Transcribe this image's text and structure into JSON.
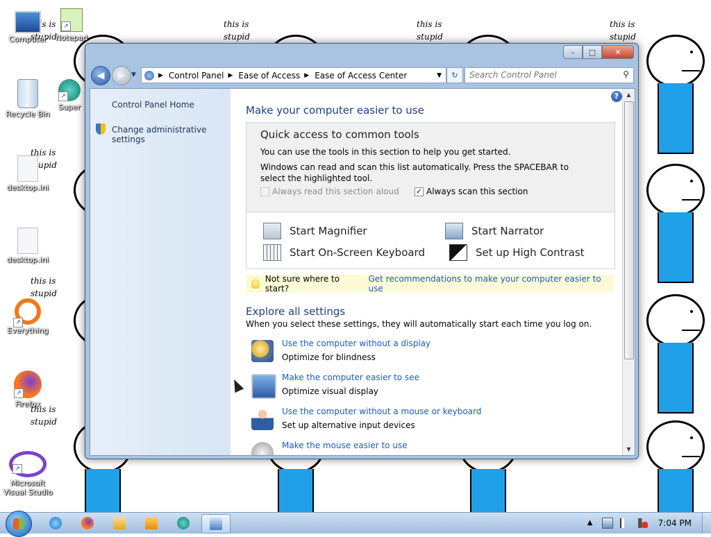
{
  "wallpaper": {
    "captions": [
      "this is stupid",
      "this is stupid",
      "this is stupid",
      "this is stupid",
      "this is stupid",
      "this is stupid",
      "this is stupid",
      "this is stupid"
    ]
  },
  "desktop_icons": [
    {
      "label": "Computer"
    },
    {
      "label": "Notepad"
    },
    {
      "label": "Recycle Bin"
    },
    {
      "label": "Super"
    },
    {
      "label": "desktop.ini"
    },
    {
      "label": "desktop.ini"
    },
    {
      "label": "Everything"
    },
    {
      "label": "Firefox"
    },
    {
      "label": "Microsoft Visual Studio"
    }
  ],
  "window": {
    "titlebar": {
      "minimize": "–",
      "maximize": "□",
      "close": "✕"
    },
    "nav": {
      "back": "◀",
      "forward": "▶"
    },
    "address": {
      "crumbs": [
        "Control Panel",
        "Ease of Access",
        "Ease of Access Center"
      ],
      "separator": "▶",
      "dropdown": "▼"
    },
    "refresh": "↻",
    "search": {
      "placeholder": "Search Control Panel"
    },
    "help": "?",
    "sidebar": {
      "home": "Control Panel Home",
      "admin": "Change administrative settings"
    },
    "main": {
      "title": "Make your computer easier to use",
      "quick_access": {
        "title": "Quick access to common tools",
        "line1": "You can use the tools in this section to help you get started.",
        "line2": "Windows can read and scan this list automatically.  Press the SPACEBAR to select the highlighted tool.",
        "read_aloud": "Always read this section aloud",
        "scan": "Always scan this section",
        "scan_checked": "✓"
      },
      "tools": [
        {
          "label": "Start Magnifier"
        },
        {
          "label": "Start Narrator"
        },
        {
          "label": "Start On-Screen Keyboard"
        },
        {
          "label": "Set up High Contrast"
        }
      ],
      "tip": {
        "text": "Not sure where to start?",
        "link": "Get recommendations to make your computer easier to use"
      },
      "explore": {
        "title": "Explore all settings",
        "subtitle": "When you select these settings, they will automatically start each time you log on."
      },
      "settings": [
        {
          "link": "Use the computer without a display",
          "desc": "Optimize for blindness"
        },
        {
          "link": "Make the computer easier to see",
          "desc": "Optimize visual display"
        },
        {
          "link": "Use the computer without a mouse or keyboard",
          "desc": "Set up alternative input devices"
        },
        {
          "link": "Make the mouse easier to use",
          "desc": ""
        }
      ]
    }
  },
  "taskbar": {
    "clock": "7:04 PM"
  },
  "colors": {
    "link": "#1a5ac2",
    "heading": "#1e3e80",
    "figure_body": "#1fa0e8"
  }
}
